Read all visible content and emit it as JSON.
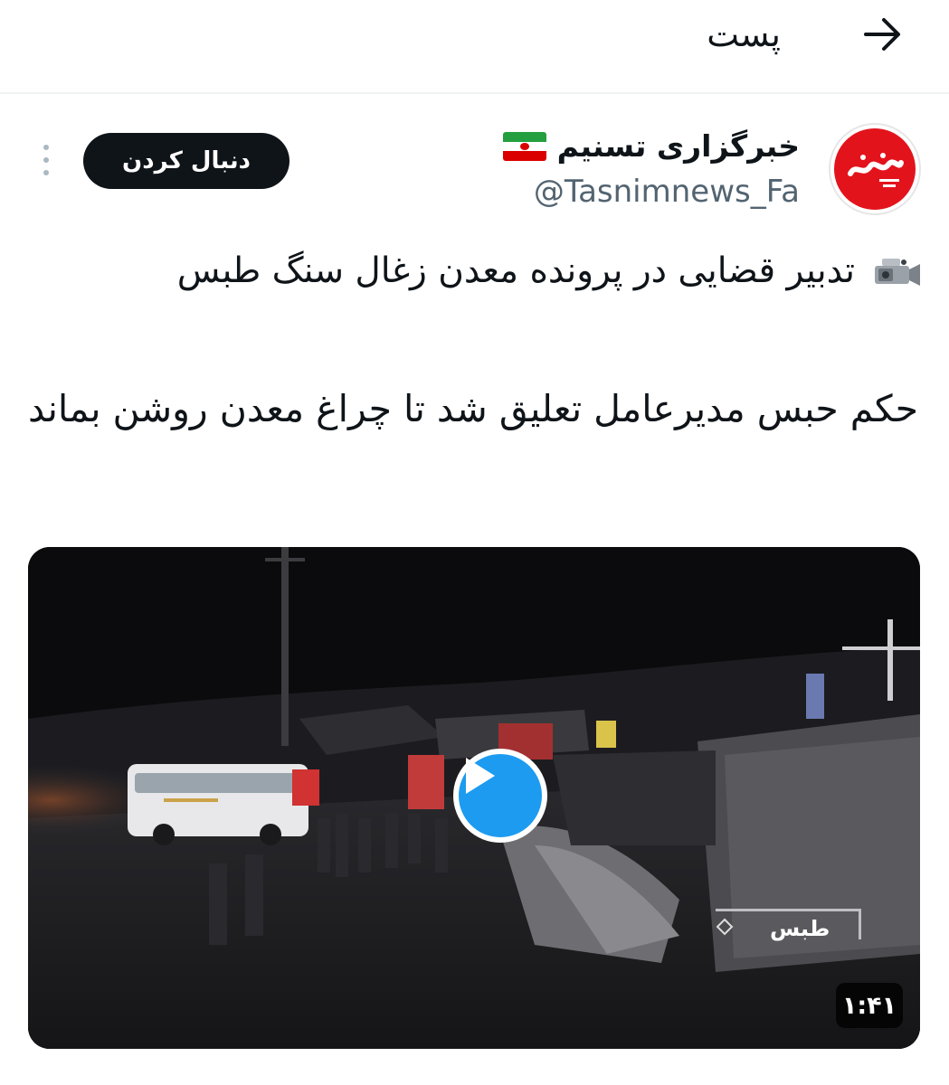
{
  "header": {
    "title": "پست"
  },
  "author": {
    "display_name": "خبرگزاری تسنیم",
    "handle": "@Tasnimnews_Fa",
    "follow_label": "دنبال کردن"
  },
  "tweet": {
    "headline": "تدبیر قضایی در پرونده معدن زغال سنگ طبس",
    "body": "حکم حبس مدیرعامل تعلیق شد تا چراغ معدن روشن بماند"
  },
  "video": {
    "duration": "۱:۴۱",
    "location_label": "طبس"
  },
  "colors": {
    "accent": "#1d9bf0",
    "follow_bg": "#0f1419",
    "handle": "#536471",
    "avatar_red": "#e3131c"
  },
  "icons": {
    "back": "arrow-right-icon",
    "more": "more-vertical-icon",
    "camera": "video-camera-icon",
    "play": "play-icon",
    "flag": "iran-flag-icon"
  }
}
